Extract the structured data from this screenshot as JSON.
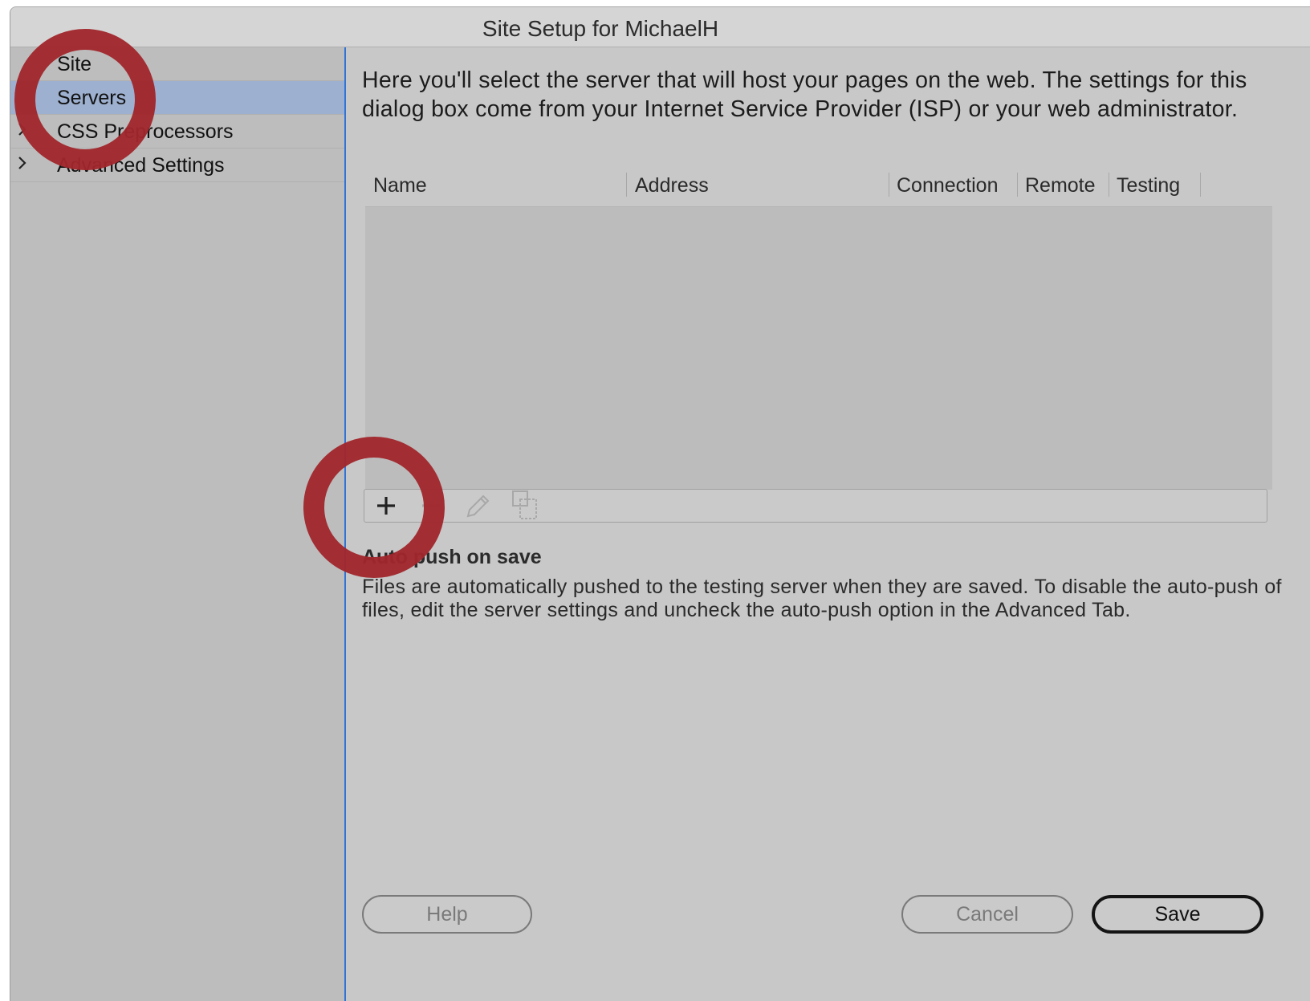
{
  "window": {
    "title": "Site Setup for MichaelH"
  },
  "sidebar": {
    "items": [
      {
        "label": "Site",
        "expandable": false,
        "selected": false
      },
      {
        "label": "Servers",
        "expandable": false,
        "selected": true
      },
      {
        "label": "CSS Preprocessors",
        "expandable": true,
        "selected": false
      },
      {
        "label": "Advanced Settings",
        "expandable": true,
        "selected": false
      }
    ],
    "selection_color": "#9db0cf",
    "divider_color": "#2f74d6"
  },
  "main": {
    "intro": "Here you'll select the server that will host your pages on the web. The settings for this dialog box come from your Internet Service Provider (ISP) or your web administrator.",
    "table": {
      "columns": [
        "Name",
        "Address",
        "Connection",
        "Remote",
        "Testing"
      ],
      "rows": []
    },
    "toolbar": {
      "add_icon": "plus-icon",
      "remove_icon": "minus-icon",
      "edit_icon": "pencil-icon",
      "duplicate_icon": "duplicate-icon"
    },
    "auto_push": {
      "title": "Auto push on save",
      "body": "Files are automatically pushed to the testing server when they are saved. To disable the auto-push of files, edit the server settings and uncheck the auto-push option in the Advanced Tab."
    }
  },
  "footer": {
    "help_label": "Help",
    "cancel_label": "Cancel",
    "save_label": "Save"
  },
  "annotation_color": "#a0262c"
}
